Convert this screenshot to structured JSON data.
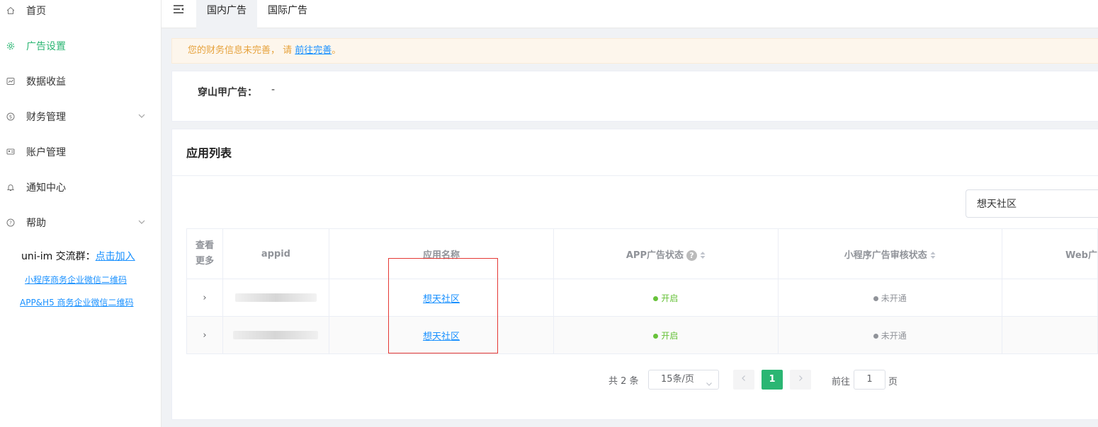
{
  "sidebar": {
    "items": [
      {
        "label": "首页",
        "icon": "home-icon"
      },
      {
        "label": "广告设置",
        "icon": "gear-icon",
        "active": true
      },
      {
        "label": "数据收益",
        "icon": "chart-icon"
      },
      {
        "label": "财务管理",
        "icon": "money-icon",
        "expandable": true
      },
      {
        "label": "账户管理",
        "icon": "account-icon"
      },
      {
        "label": "通知中心",
        "icon": "bell-icon"
      },
      {
        "label": "帮助",
        "icon": "help-icon",
        "expandable": true
      }
    ],
    "qq_label": "uni-im 交流群：",
    "qq_link": "点击加入",
    "link_mp": "小程序商务企业微信二维码",
    "link_app": "APP&H5 商务企业微信二维码"
  },
  "tabs": {
    "domestic": "国内广告",
    "international": "国际广告"
  },
  "warning": {
    "text": "您的财务信息未完善， 请 ",
    "link": "前往完善",
    "suffix": "。"
  },
  "pangolin": {
    "label": "穿山甲广告：",
    "value": "-"
  },
  "app_list": {
    "title": "应用列表",
    "search_value": "想天社区",
    "columns": {
      "more": "查看更多",
      "appid": "appid",
      "name": "应用名称",
      "app_status": "APP广告状态",
      "mp_status": "小程序广告审核状态",
      "web_status": "Web广"
    },
    "rows": [
      {
        "name": "想天社区",
        "app_status": "开启",
        "mp_status": "未开通"
      },
      {
        "name": "想天社区",
        "app_status": "开启",
        "mp_status": "未开通"
      }
    ],
    "status_colors": {
      "on": "#67c23a",
      "off": "#909399"
    }
  },
  "pagination": {
    "total": "共 2 条",
    "page_size": "15条/页",
    "current": "1",
    "goto_label": "前往",
    "goto_value": "1",
    "goto_suffix": "页"
  },
  "colors": {
    "accent": "#2bb673",
    "link": "#1890ff",
    "warning": "#e6a23c"
  }
}
